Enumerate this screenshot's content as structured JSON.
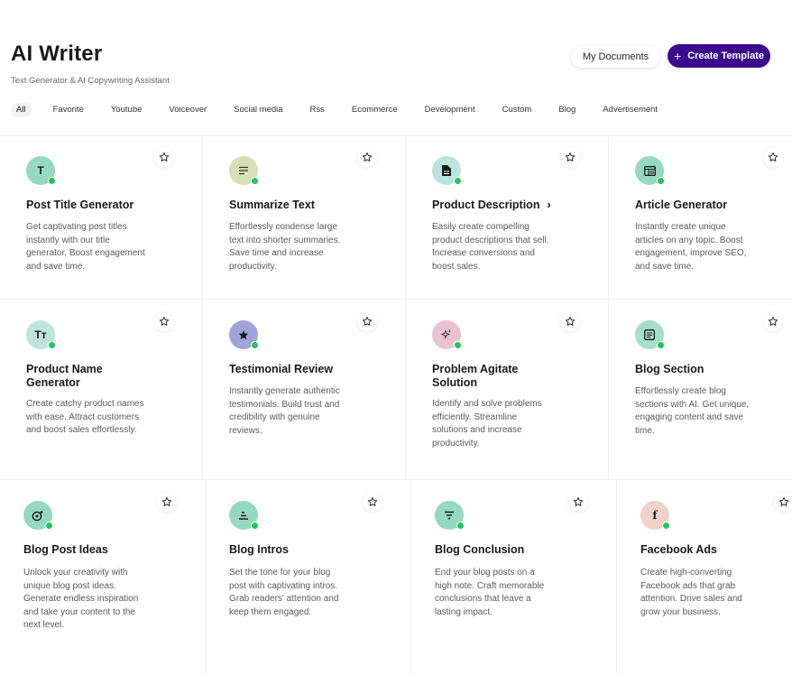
{
  "header": {
    "title": "AI Writer",
    "subtitle": "Text Generator & AI Copywriting Assistant",
    "my_documents_label": "My Documents",
    "create_template_label": "Create Template"
  },
  "filters": [
    "All",
    "Favorite",
    "Youtube",
    "Voiceover",
    "Social media",
    "Rss",
    "Ecommerce",
    "Development",
    "Custom",
    "Blog",
    "Advertisement"
  ],
  "active_filter": "All",
  "colors": {
    "accent": "#3b0a8f",
    "status_online": "#22c55e"
  },
  "cards": [
    {
      "title": "Post Title Generator",
      "desc": "Get captivating post titles instantly with our title generator. Boost engagement and save time.",
      "icon": "letter-t-icon",
      "icon_text": "T",
      "icon_bg": "#95d9c3"
    },
    {
      "title": "Summarize Text",
      "desc": "Effortlessly condense large text into shorter summaries. Save time and increase productivity.",
      "icon": "lines-icon",
      "icon_text": "",
      "icon_bg": "#d6dfb6"
    },
    {
      "title": "Product Description",
      "desc": "Easily create compelling product descriptions that sell. Increase conversions and boost sales.",
      "icon": "document-icon",
      "icon_text": "",
      "icon_bg": "#b9e4e0"
    },
    {
      "title": "Article Generator",
      "desc": "Instantly create unique articles on any topic. Boost engagement, improve SEO, and save time.",
      "icon": "article-icon",
      "icon_text": "",
      "icon_bg": "#95d9c3"
    },
    {
      "title": "Product Name Generator",
      "desc": "Create catchy product names with ease. Attract customers and boost sales effortlessly.",
      "icon": "text-size-icon",
      "icon_text": "Tт",
      "icon_bg": "#bfe4dc"
    },
    {
      "title": "Testimonial Review",
      "desc": "Instantly generate authentic testimonials. Build trust and credibility with genuine reviews.",
      "icon": "star-filled-icon",
      "icon_text": "",
      "icon_bg": "#a1a4d8"
    },
    {
      "title": "Problem Agitate Solution",
      "desc": "Identify and solve problems efficiently. Streamline solutions and increase productivity.",
      "icon": "sparkle-icon",
      "icon_text": "",
      "icon_bg": "#ebc2d1"
    },
    {
      "title": "Blog Section",
      "desc": "Effortlessly create blog sections with AI. Get unique, engaging content and save time.",
      "icon": "blog-section-icon",
      "icon_text": "",
      "icon_bg": "#a6dfc8"
    },
    {
      "title": "Blog Post Ideas",
      "desc": "Unlock your creativity with unique blog post ideas. Generate endless inspiration and take your content to the next level.",
      "icon": "idea-icon",
      "icon_text": "",
      "icon_bg": "#95d9c3"
    },
    {
      "title": "Blog Intros",
      "desc": "Set the tone for your blog post with captivating intros. Grab readers' attention and keep them engaged.",
      "icon": "intro-lines-icon",
      "icon_text": "",
      "icon_bg": "#95d9c3"
    },
    {
      "title": "Blog Conclusion",
      "desc": "End your blog posts on a high note. Craft memorable conclusions that leave a lasting impact.",
      "icon": "filter-lines-icon",
      "icon_text": "",
      "icon_bg": "#95d9c3"
    },
    {
      "title": "Facebook Ads",
      "desc": "Create high-converting Facebook ads that grab attention. Drive sales and grow your business.",
      "icon": "facebook-icon",
      "icon_text": "f",
      "icon_bg": "#f0d2c8"
    }
  ]
}
